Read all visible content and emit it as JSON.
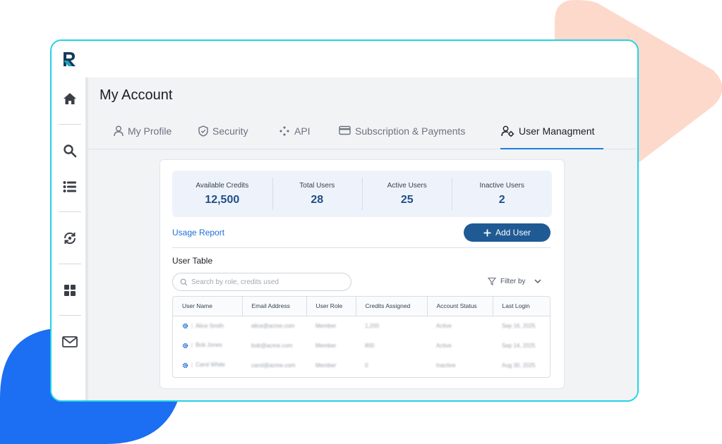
{
  "colors": {
    "window_border": "#22d3e6",
    "accent": "#1e7fe0",
    "primary_button": "#1f5a94",
    "stat_value": "#1f4f86",
    "bg_triangle": "#fdd9cc",
    "bg_blob": "#1c6ef2"
  },
  "sidebar": {
    "items": [
      {
        "icon": "home-icon"
      },
      {
        "icon": "search-icon"
      },
      {
        "icon": "list-icon"
      },
      {
        "icon": "sync-icon"
      },
      {
        "icon": "grid-icon"
      },
      {
        "icon": "mail-icon"
      }
    ]
  },
  "page": {
    "title": "My Account"
  },
  "tabs": [
    {
      "label": "My Profile",
      "icon": "user-icon",
      "active": false
    },
    {
      "label": "Security",
      "icon": "shield-icon",
      "active": false
    },
    {
      "label": "API",
      "icon": "api-icon",
      "active": false
    },
    {
      "label": "Subscription & Payments",
      "icon": "card-icon",
      "active": false
    },
    {
      "label": "User Managment",
      "icon": "user-gear-icon",
      "active": true
    }
  ],
  "stats": [
    {
      "label": "Available Credits",
      "value": "12,500"
    },
    {
      "label": "Total Users",
      "value": "28"
    },
    {
      "label": "Active Users",
      "value": "25"
    },
    {
      "label": "Inactive Users",
      "value": "2"
    }
  ],
  "actions": {
    "usage_report": "Usage Report",
    "add_user": "Add User"
  },
  "table": {
    "title": "User Table",
    "search_placeholder": "Search by role, credits used",
    "filter_label": "Filter by",
    "columns": [
      "User Name",
      "Email Address",
      "User Role",
      "Credits Assigned",
      "Account Status",
      "Last Login"
    ],
    "rows": [
      [
        "Alice Smith",
        "alice@acme.com",
        "Member",
        "1,200",
        "Active",
        "Sep 16, 2025"
      ],
      [
        "Bob Jones",
        "bob@acme.com",
        "Member",
        "800",
        "Active",
        "Sep 14, 2025"
      ],
      [
        "Carol White",
        "carol@acme.com",
        "Member",
        "0",
        "Inactive",
        "Aug 30, 2025"
      ]
    ]
  }
}
